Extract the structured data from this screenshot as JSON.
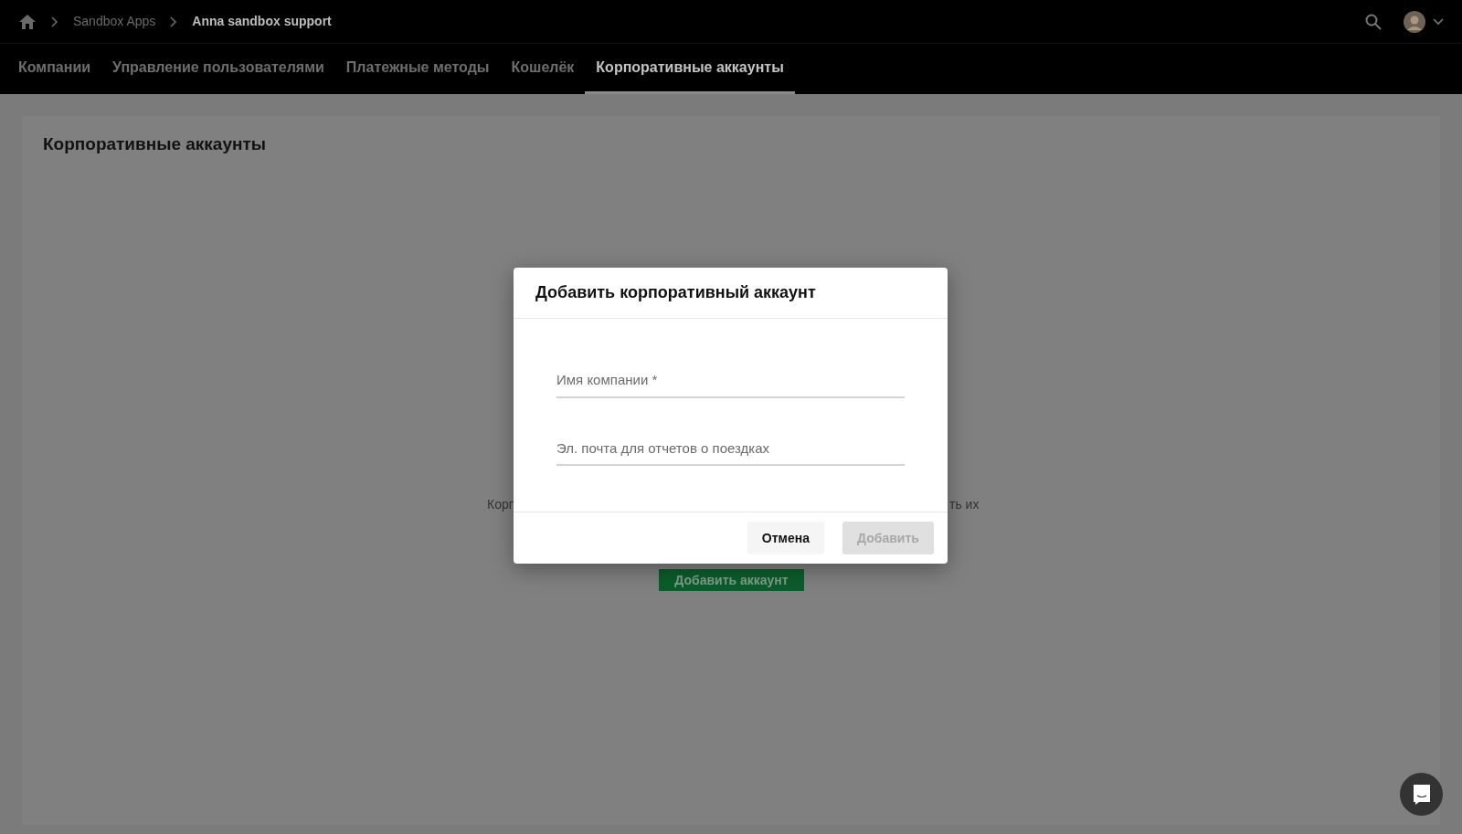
{
  "breadcrumbs": [
    {
      "label": "Sandbox Apps",
      "current": false
    },
    {
      "label": "Anna sandbox support",
      "current": true
    }
  ],
  "tabs": [
    {
      "label": "Компании",
      "selected": false
    },
    {
      "label": "Управление пользователями",
      "selected": false
    },
    {
      "label": "Платежные методы",
      "selected": false
    },
    {
      "label": "Кошелёк",
      "selected": false
    },
    {
      "label": "Корпоративные аккаунты",
      "selected": true
    }
  ],
  "page": {
    "title": "Корпоративные аккаунты",
    "text_left": "Корп",
    "text_right": "ть их",
    "button": "Добавить аккаунт"
  },
  "modal": {
    "title": "Добавить корпоративный аккаунт",
    "fields": [
      {
        "placeholder": "Имя компании *"
      },
      {
        "placeholder": "Эл. почта для отчетов о поездках"
      }
    ],
    "buttons": [
      {
        "label": "Отмена",
        "disabled": false
      },
      {
        "label": "Добавить",
        "disabled": true
      }
    ]
  }
}
